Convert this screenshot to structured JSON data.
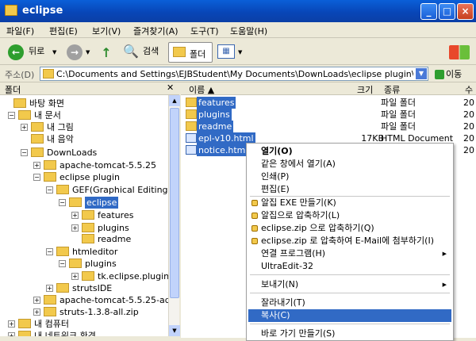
{
  "window": {
    "title": "eclipse"
  },
  "menu": [
    "파일(F)",
    "편집(E)",
    "보기(V)",
    "즐겨찾기(A)",
    "도구(T)",
    "도움말(H)"
  ],
  "toolbar": {
    "back_label": "뒤로",
    "search_label": "검색",
    "folders_label": "폴더"
  },
  "address": {
    "label": "주소(D)",
    "value": "C:\\Documents and Settings\\EJBStudent\\My Documents\\DownLoads\\eclipse plugin\\",
    "go_label": "이동"
  },
  "tree": {
    "title": "폴더",
    "nodes": [
      {
        "label": "바탕 화면",
        "expander": ""
      },
      {
        "label": "내 문서",
        "expander": "−"
      },
      {
        "label": "내 그림",
        "expander": "+"
      },
      {
        "label": "내 음악",
        "expander": ""
      },
      {
        "label": "DownLoads",
        "expander": "−"
      },
      {
        "label": "apache-tomcat-5.5.25",
        "expander": "+"
      },
      {
        "label": "eclipse plugin",
        "expander": "−"
      },
      {
        "label": "GEF(Graphical Editing F",
        "expander": "−"
      },
      {
        "label": "eclipse",
        "expander": "−"
      },
      {
        "label": "features",
        "expander": "+"
      },
      {
        "label": "plugins",
        "expander": "+"
      },
      {
        "label": "readme",
        "expander": ""
      },
      {
        "label": "htmleditor",
        "expander": "−"
      },
      {
        "label": "plugins",
        "expander": "−"
      },
      {
        "label": "tk.eclipse.plugin.",
        "expander": "+"
      },
      {
        "label": "strutsIDE",
        "expander": "+"
      },
      {
        "label": "apache-tomcat-5.5.25-adm",
        "expander": "+"
      },
      {
        "label": "struts-1.3.8-all.zip",
        "expander": "+"
      },
      {
        "label": "내 컴퓨터",
        "expander": "+"
      },
      {
        "label": "내 네트워크 환경",
        "expander": "+"
      }
    ]
  },
  "list": {
    "columns": {
      "name": "이름",
      "size": "크기",
      "type": "종류",
      "date": "수"
    },
    "rows": [
      {
        "name": "features",
        "size": "",
        "type": "파일 폴더",
        "date": "20"
      },
      {
        "name": "plugins",
        "size": "",
        "type": "파일 폴더",
        "date": "20"
      },
      {
        "name": "readme",
        "size": "",
        "type": "파일 폴더",
        "date": "20"
      },
      {
        "name": "epl-v10.html",
        "size": "17KB",
        "type": "HTML Document",
        "date": "20"
      },
      {
        "name": "notice.html",
        "size": "",
        "type": "",
        "date": "20"
      }
    ]
  },
  "context_menu": {
    "items": [
      {
        "label": "열기(O)"
      },
      {
        "label": "같은 창에서 열기(A)"
      },
      {
        "label": "인쇄(P)"
      },
      {
        "label": "편집(E)"
      },
      {
        "label": "알집 EXE 만들기(K)"
      },
      {
        "label": "알집으로 압축하기(L)"
      },
      {
        "label": "eclipse.zip 으로 압축하기(Q)"
      },
      {
        "label": "eclipse.zip 로 압축하여 E-Mail에 첨부하기(I)"
      },
      {
        "label": "연결 프로그램(H)"
      },
      {
        "label": "UltraEdit-32"
      },
      {
        "label": "보내기(N)"
      },
      {
        "label": "잘라내기(T)"
      },
      {
        "label": "복사(C)"
      },
      {
        "label": "바로 가기 만들기(S)"
      }
    ]
  },
  "colors": {
    "titlebar": "#0846b8",
    "selection": "#316ac5",
    "folder": "#f2c94c"
  }
}
